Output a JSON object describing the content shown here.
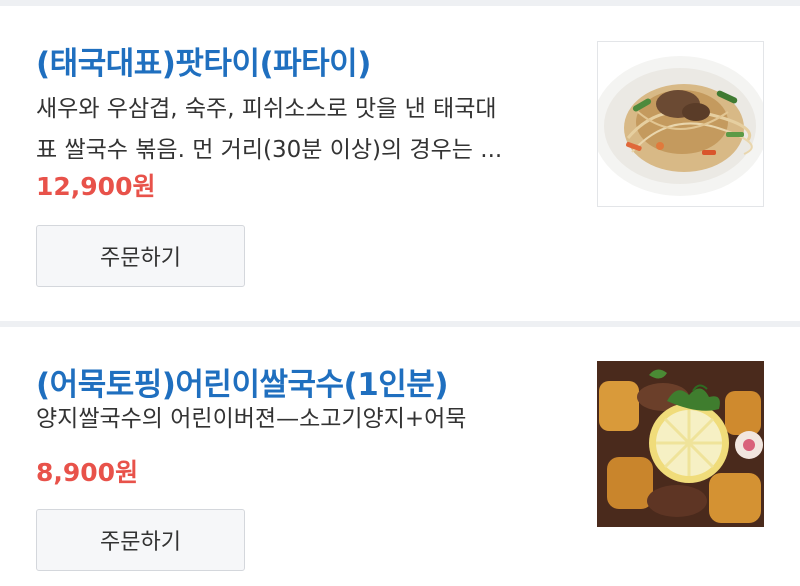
{
  "items": [
    {
      "title": "(태국대표)팟타이(파타이)",
      "description": "새우와 우삼겹, 숙주, 피쉬소스로 맛을 낸 태국대\n표 쌀국수 볶음. 먼 거리(30분 이상)의 경우는 ...",
      "price": "12,900원",
      "order_label": "주문하기",
      "image_icon": "pad-thai-photo"
    },
    {
      "title": "(어묵토핑)어린이쌀국수(1인분)",
      "description": "양지쌀국수의 어린이버젼—소고기양지+어묵",
      "price": "8,900원",
      "order_label": "주문하기",
      "image_icon": "kids-rice-noodle-photo"
    }
  ],
  "colors": {
    "title": "#1f6fbf",
    "price": "#e8524a",
    "divider": "#eef0f3"
  }
}
